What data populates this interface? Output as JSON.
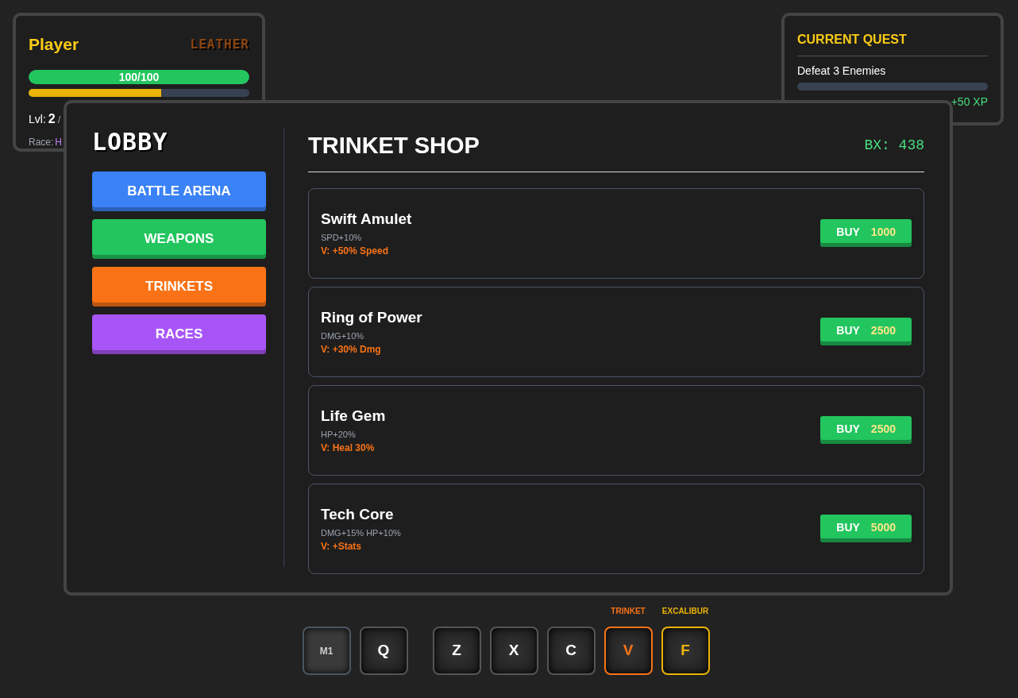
{
  "player": {
    "name": "Player",
    "armor": "LEATHER",
    "hp": {
      "text": "100/100",
      "level": 1
    },
    "xp": {
      "level": 0.6
    },
    "level_label": "Lvl:",
    "level_value": "2",
    "xp_text": "/",
    "race_label": "Race:",
    "race": "H"
  },
  "quest": {
    "title": "CURRENT QUEST",
    "name": "Defeat 3 Enemies",
    "progress": {
      "level": 0
    },
    "reward": "+50 XP"
  },
  "lobby": {
    "title": "LOBBY",
    "menu": [
      {
        "label": "BATTLE ARENA",
        "color": "#3b82f6"
      },
      {
        "label": "WEAPONS",
        "color": "#22c55e"
      },
      {
        "label": "TRINKETS",
        "color": "#f97316"
      },
      {
        "label": "RACES",
        "color": "#a855f7"
      }
    ]
  },
  "shop": {
    "title": "TRINKET SHOP",
    "balance": "BX: 438",
    "items": [
      {
        "name": "Swift Amulet",
        "stats": "SPD+10%",
        "bonus": "V: +50% Speed",
        "buy": "BUY",
        "price": "1000"
      },
      {
        "name": "Ring of Power",
        "stats": "DMG+10%",
        "bonus": "V: +30% Dmg",
        "buy": "BUY",
        "price": "2500"
      },
      {
        "name": "Life Gem",
        "stats": "HP+20%",
        "bonus": "V: Heal 30%",
        "buy": "BUY",
        "price": "2500"
      },
      {
        "name": "Tech Core",
        "stats": "DMG+15% HP+10%",
        "bonus": "V: +Stats",
        "buy": "BUY",
        "price": "5000"
      }
    ]
  },
  "hotbar": {
    "groups": [
      [
        {
          "key": "M1",
          "kind": "mouse"
        },
        {
          "key": "Q",
          "kind": "key"
        }
      ],
      [
        {
          "key": "Z",
          "kind": "key"
        },
        {
          "key": "X",
          "kind": "key"
        },
        {
          "key": "C",
          "kind": "key"
        },
        {
          "key": "V",
          "kind": "key",
          "label": "TRINKET",
          "color": "#f97316"
        },
        {
          "key": "F",
          "kind": "key",
          "label": "EXCALIBUR",
          "color": "#eab308"
        }
      ]
    ]
  }
}
